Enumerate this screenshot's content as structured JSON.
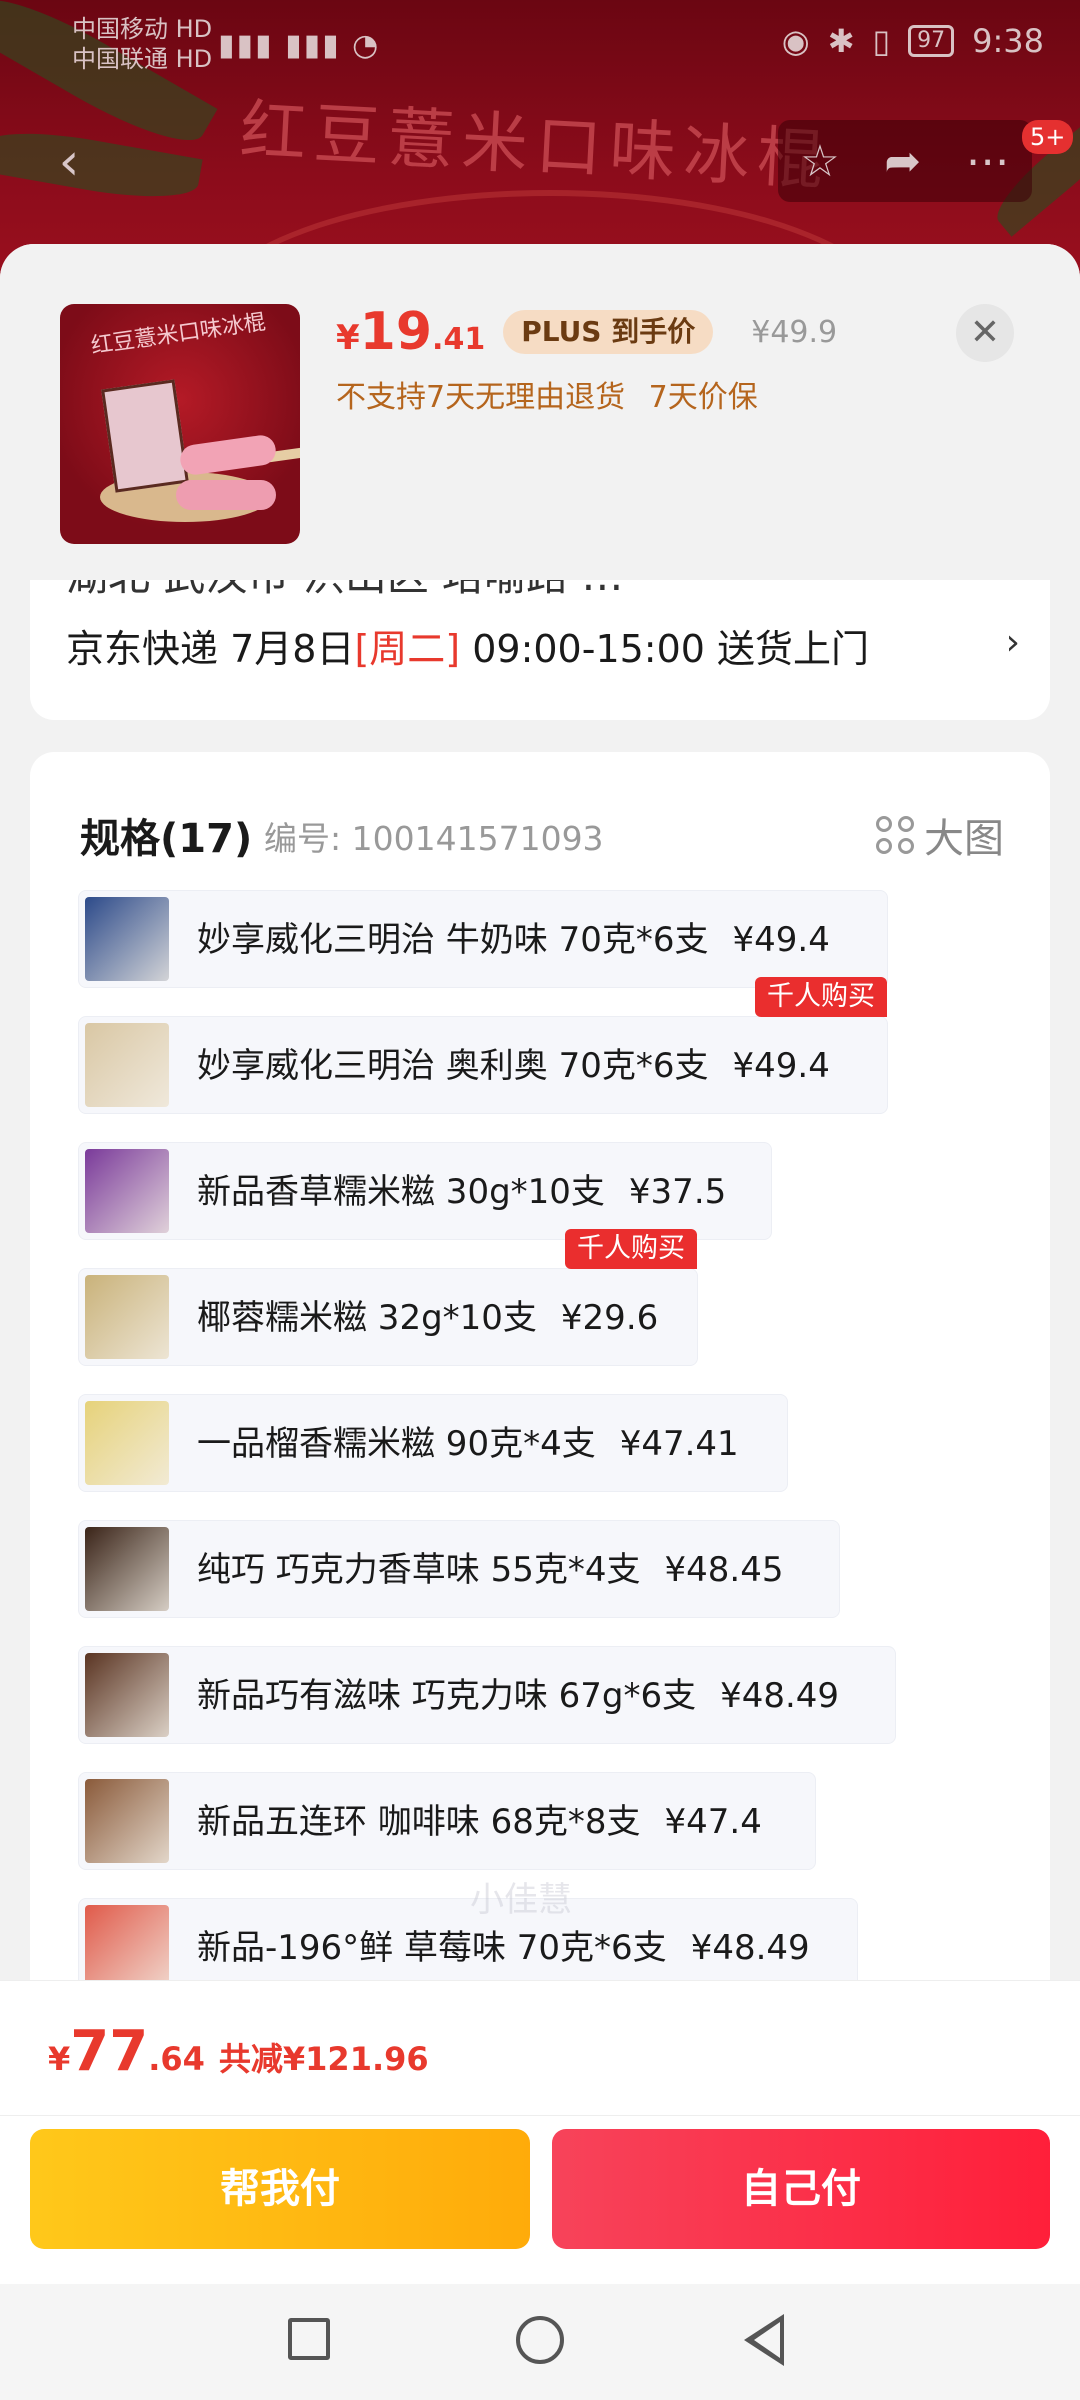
{
  "status_bar": {
    "carrier_line1": "中国移动 HD",
    "carrier_line2": "中国联通 HD",
    "signal": "5G 4G",
    "battery": "97",
    "time": "9:38"
  },
  "background": {
    "product_title": "红豆薏米口味冰棍",
    "share_badge": "5+"
  },
  "sku_header": {
    "price_symbol": "¥",
    "price_int": "19",
    "price_dec": ".41",
    "plus_tag": "PLUS 到手价",
    "original_price": "¥49.9",
    "policy_no_return": "不支持7天无理由退货",
    "policy_price_protect": "7天价保",
    "close_icon": "✕",
    "thumb_text": "红豆薏米口味冰棍"
  },
  "address": {
    "partial_line": "湖北 武汉市 洪山区 珞喻路 …",
    "carrier": "京东快递",
    "date": "7月8日",
    "weekday": "[周二]",
    "window": "09:00-15:00 送货上门"
  },
  "spec": {
    "title": "规格(17)",
    "code": "编号: 100141571093",
    "bigpic_label": "大图",
    "hot_tag": "千人购买",
    "watermark": "小佳慧",
    "options": [
      {
        "label": "妙享威化三明治 牛奶味 70克*6支",
        "price": "¥49.4",
        "hot": false,
        "color": "#2c4a8a"
      },
      {
        "label": "妙享威化三明治 奥利奥 70克*6支",
        "price": "¥49.4",
        "hot": true,
        "color": "#d9c7a4"
      },
      {
        "label": "新品香草糯米糍 30g*10支",
        "price": "¥37.5",
        "hot": false,
        "color": "#7a3a9a"
      },
      {
        "label": "椰蓉糯米糍 32g*10支",
        "price": "¥29.6",
        "hot": true,
        "color": "#c9b27a"
      },
      {
        "label": "一品榴香糯米糍 90克*4支",
        "price": "¥47.41",
        "hot": false,
        "color": "#e6d27a"
      },
      {
        "label": "纯巧 巧克力香草味 55克*4支",
        "price": "¥48.45",
        "hot": false,
        "color": "#3a2418"
      },
      {
        "label": "新品巧有滋味 巧克力味 67g*6支",
        "price": "¥48.49",
        "hot": false,
        "color": "#5a3422"
      },
      {
        "label": "新品五连环 咖啡味 68克*8支",
        "price": "¥47.4",
        "hot": false,
        "color": "#8a5a3a"
      },
      {
        "label": "新品-196°鲜 草莓味 70克*6支",
        "price": "¥48.49",
        "hot": false,
        "color": "#e05a4a"
      }
    ]
  },
  "footer": {
    "total_symbol": "¥",
    "total_int": "77",
    "total_dec": ".64",
    "discount": "共减¥121.96",
    "help_pay": "帮我付",
    "self_pay": "自己付"
  },
  "colors": {
    "accent_red": "#e8392d",
    "plus_gold": "#f6dcc4",
    "help_btn": "#ffb70f",
    "self_btn": "#fa2d48"
  }
}
